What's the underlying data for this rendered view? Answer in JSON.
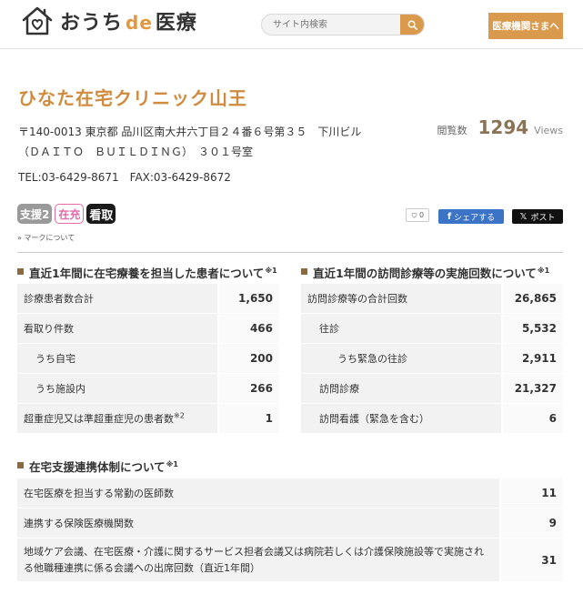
{
  "header": {
    "logo_text": "おうち",
    "logo_de": "de",
    "logo_text2": "医療",
    "search_placeholder": "サイト内検索",
    "medical_btn": "医療機関さまへ"
  },
  "clinic": {
    "name": "ひなた在宅クリニック山王",
    "address_line1": "〒140-0013 東京都 品川区南大井六丁目２４番６号第３５　下川ビル",
    "address_line2": "（ＤＡＩＴＯ　ＢＵＩＬＤＩＮＧ）　３０１号室",
    "phone": "TEL:03-6429-8671　FAX:03-6429-8672",
    "views_label": "閲覧数",
    "views_count": "1294",
    "views_unit": "Views"
  },
  "badges": {
    "shien": "支援2",
    "zaiju": "在充",
    "mitori": "看取",
    "mark_link": "» マークについて"
  },
  "social": {
    "like_count": "0",
    "fb_label": "シェアする",
    "x_label": "ポスト"
  },
  "section1": {
    "title": "直近1年間に在宅療養を担当した患者について",
    "note": "※1",
    "rows": [
      {
        "label": "診療患者数合計",
        "value": "1,650"
      },
      {
        "label": "看取り件数",
        "value": "466"
      },
      {
        "label": "うち自宅",
        "value": "200"
      },
      {
        "label": "うち施設内",
        "value": "266"
      },
      {
        "label": "超重症児又は準超重症児の患者数",
        "note": "※2",
        "value": "1"
      }
    ]
  },
  "section2": {
    "title": "直近1年間の訪問診療等の実施回数について",
    "note": "※1",
    "rows": [
      {
        "label": "訪問診療等の合計回数",
        "value": "26,865"
      },
      {
        "label": "往診",
        "value": "5,532"
      },
      {
        "label": "うち緊急の往診",
        "value": "2,911"
      },
      {
        "label": "訪問診療",
        "value": "21,327"
      },
      {
        "label": "訪問看護（緊急を含む）",
        "value": "6"
      }
    ]
  },
  "section3": {
    "title": "在宅支援連携体制について",
    "note": "※1",
    "rows": [
      {
        "label": "在宅医療を担当する常勤の医師数",
        "value": "11"
      },
      {
        "label": "連携する保険医療機関数",
        "value": "9"
      },
      {
        "label": "地域ケア会議、在宅医療・介護に関するサービス担者会議又は病院若しくは介護保険施設等で実施される他職種連携に係る会議への出席回数（直近1年間）",
        "value": "31"
      }
    ]
  },
  "colors": {
    "accent": "#d99a4e",
    "title": "#d08b3e"
  }
}
